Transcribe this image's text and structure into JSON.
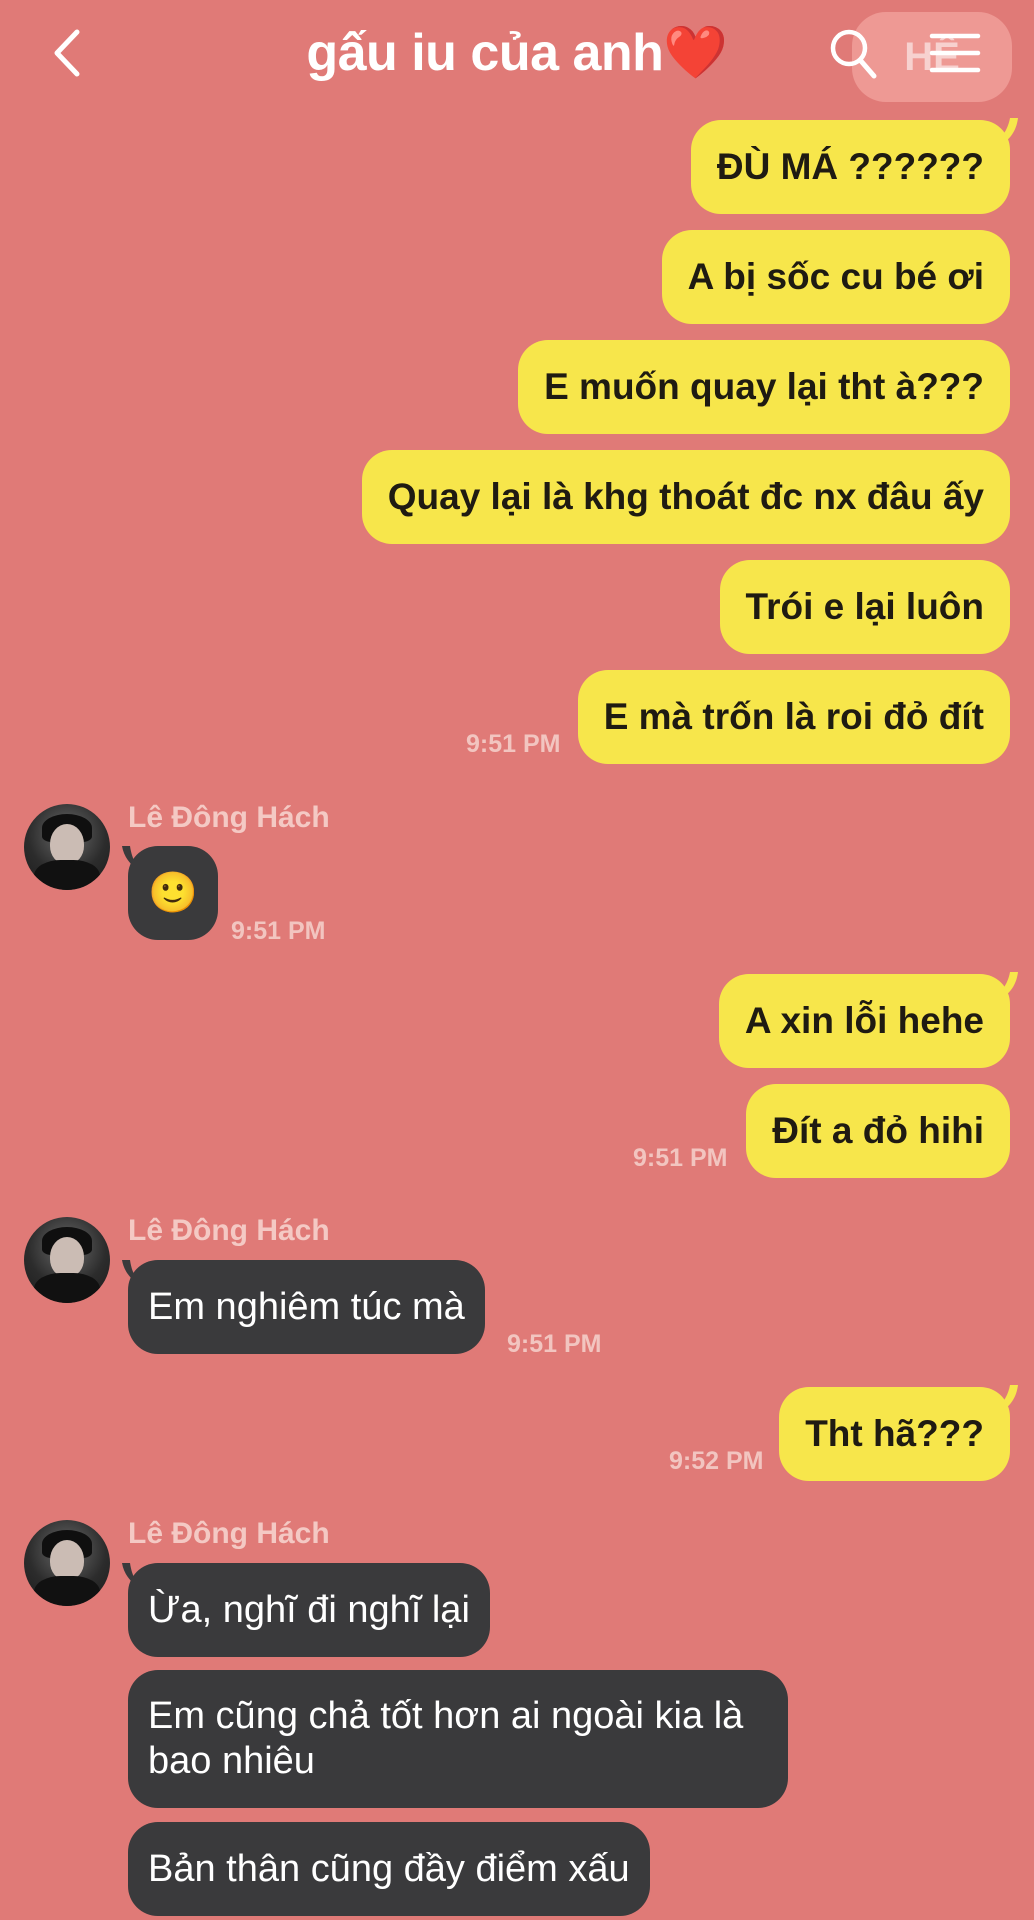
{
  "header": {
    "title": "gấu iu của anh❤️",
    "back_icon": "chevron-left-icon",
    "search_icon": "search-icon",
    "menu_icon": "hamburger-menu-icon",
    "watermark": "HÊ"
  },
  "contact": {
    "name": "Lê Đông Hách"
  },
  "colors": {
    "background": "#e07a77",
    "sent_bubble": "#f7e64b",
    "received_bubble": "#3a3a3c"
  },
  "messages": [
    {
      "dir": "sent",
      "text": "ĐÙ MÁ ??????"
    },
    {
      "dir": "sent",
      "text": "A bị sốc cu bé ơi"
    },
    {
      "dir": "sent",
      "text": "E muốn quay lại tht à???"
    },
    {
      "dir": "sent",
      "text": "Quay lại là khg thoát đc nx đâu ấy"
    },
    {
      "dir": "sent",
      "text": "Trói e lại luôn"
    },
    {
      "dir": "sent",
      "text": "E mà trốn là roi đỏ đít",
      "time": "9:51 PM"
    },
    {
      "dir": "received",
      "sender": "Lê Đông Hách",
      "text": "🙂",
      "time": "9:51 PM"
    },
    {
      "dir": "sent",
      "text": "A xin lỗi hehe"
    },
    {
      "dir": "sent",
      "text": "Đít a đỏ hihi",
      "time": "9:51 PM"
    },
    {
      "dir": "received",
      "sender": "Lê Đông Hách",
      "text": "Em nghiêm túc mà",
      "time": "9:51 PM"
    },
    {
      "dir": "sent",
      "text": "Tht hã???",
      "time": "9:52 PM"
    },
    {
      "dir": "received",
      "sender": "Lê Đông Hách",
      "text": "Ừa, nghĩ đi nghĩ lại"
    },
    {
      "dir": "received",
      "text": "Em cũng chả tốt hơn ai ngoài kia là bao nhiêu"
    },
    {
      "dir": "received",
      "text": "Bản thân cũng đầy điểm xấu"
    }
  ]
}
